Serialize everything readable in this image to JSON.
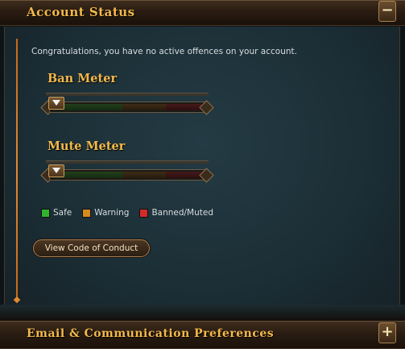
{
  "account_status": {
    "title": "Account Status",
    "toggle_label": "−",
    "message": "Congratulations, you have no active offences on your account.",
    "ban_meter": {
      "label": "Ban Meter",
      "level": 0
    },
    "mute_meter": {
      "label": "Mute Meter",
      "level": 0
    },
    "legend": [
      {
        "label": "Safe",
        "color": "#2fb52c"
      },
      {
        "label": "Warning",
        "color": "#d88a1c"
      },
      {
        "label": "Banned/Muted",
        "color": "#d42a2a"
      }
    ],
    "code_of_conduct_button": "View Code of Conduct"
  },
  "email_section": {
    "title": "Email & Communication Preferences",
    "toggle_label": "+"
  },
  "colors": {
    "accent_gold": "#f3b94a",
    "orange_line": "#e38a2c"
  }
}
